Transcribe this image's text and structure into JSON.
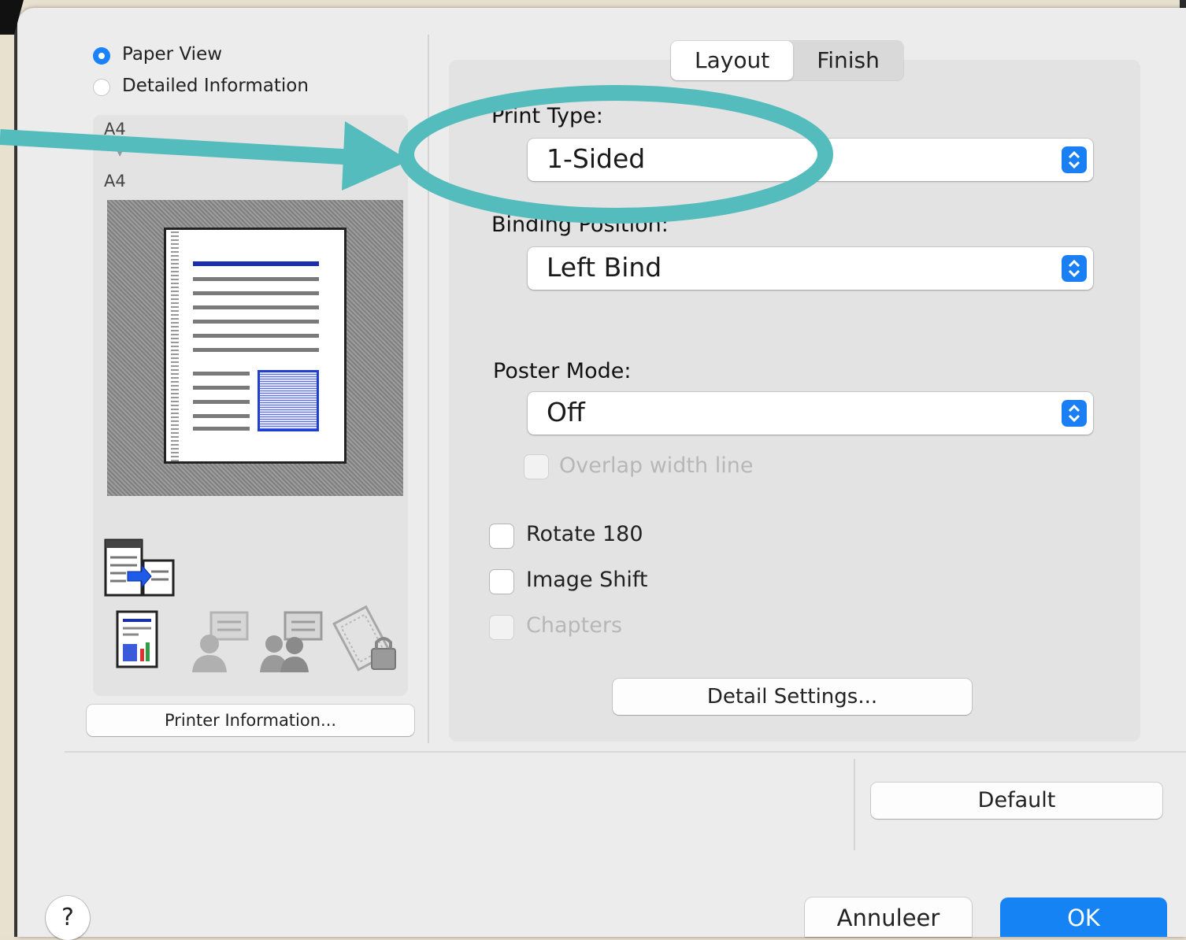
{
  "view_options": {
    "paper_view": "Paper View",
    "detailed_information": "Detailed Information",
    "selected": "Paper View"
  },
  "preview": {
    "source_size": "A4",
    "output_size": "A4"
  },
  "printer_information_button": "Printer Information...",
  "tabs": [
    {
      "label": "Layout",
      "active": true
    },
    {
      "label": "Finish",
      "active": false
    }
  ],
  "print_type": {
    "label": "Print Type:",
    "value": "1-Sided"
  },
  "binding_position": {
    "label": "Binding Position:",
    "value": "Left Bind"
  },
  "poster_mode": {
    "label": "Poster Mode:",
    "value": "Off"
  },
  "checkboxes": {
    "overlap_width_line": {
      "label": "Overlap width line",
      "checked": false,
      "enabled": false
    },
    "rotate_180": {
      "label": "Rotate 180",
      "checked": false,
      "enabled": true
    },
    "image_shift": {
      "label": "Image Shift",
      "checked": false,
      "enabled": true
    },
    "chapters": {
      "label": "Chapters",
      "checked": false,
      "enabled": false
    }
  },
  "detail_settings_button": "Detail Settings...",
  "default_button": "Default",
  "help_button": "?",
  "cancel_button": "Annuleer",
  "ok_button": "OK",
  "colors": {
    "accent": "#1583f4",
    "annotation": "#54bcbc"
  },
  "icons": [
    "printer-send-icon",
    "document-chart-icon",
    "user-comment-icon",
    "group-comment-icon",
    "secure-print-icon",
    "question-icon",
    "up-down-chevron-icon"
  ]
}
